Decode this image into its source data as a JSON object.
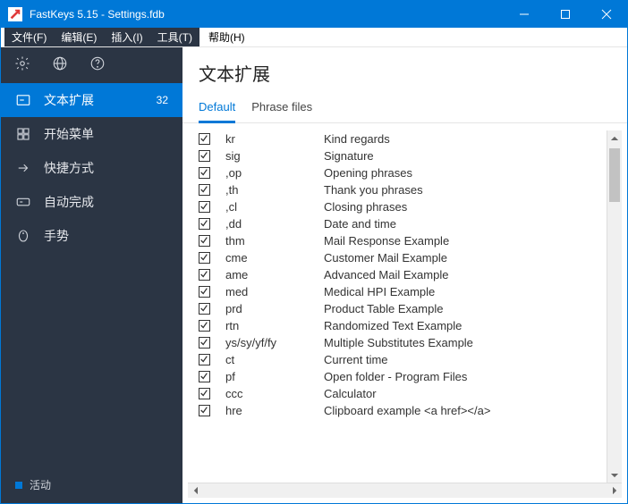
{
  "window": {
    "title": "FastKeys 5.15  -  Settings.fdb"
  },
  "menubar": {
    "group": [
      "文件(F)",
      "编辑(E)",
      "插入(I)",
      "工具(T)"
    ],
    "right": "帮助(H)"
  },
  "sidebar": {
    "items": [
      {
        "icon": "text-expand",
        "label": "文本扩展",
        "count": "32",
        "active": true
      },
      {
        "icon": "start-menu",
        "label": "开始菜单"
      },
      {
        "icon": "shortcut",
        "label": "快捷方式"
      },
      {
        "icon": "autocomplete",
        "label": "自动完成"
      },
      {
        "icon": "gesture",
        "label": "手势"
      }
    ],
    "status": "活动"
  },
  "page": {
    "title": "文本扩展",
    "tabs": [
      {
        "label": "Default",
        "active": true
      },
      {
        "label": "Phrase files",
        "active": false
      }
    ]
  },
  "rows": [
    {
      "checked": true,
      "key": "kr",
      "desc": "Kind regards"
    },
    {
      "checked": true,
      "key": "sig",
      "desc": "Signature"
    },
    {
      "checked": true,
      "key": ",op",
      "desc": "Opening phrases"
    },
    {
      "checked": true,
      "key": ",th",
      "desc": "Thank you phrases"
    },
    {
      "checked": true,
      "key": ",cl",
      "desc": "Closing phrases"
    },
    {
      "checked": true,
      "key": ",dd",
      "desc": "Date and time"
    },
    {
      "checked": true,
      "key": "thm",
      "desc": "Mail Response Example"
    },
    {
      "checked": true,
      "key": "cme",
      "desc": "Customer Mail Example"
    },
    {
      "checked": true,
      "key": "ame",
      "desc": "Advanced Mail Example"
    },
    {
      "checked": true,
      "key": "med",
      "desc": "Medical HPI Example"
    },
    {
      "checked": true,
      "key": "prd",
      "desc": "Product Table Example"
    },
    {
      "checked": true,
      "key": "rtn",
      "desc": "Randomized Text Example"
    },
    {
      "checked": true,
      "key": "ys/sy/yf/fy",
      "desc": "Multiple Substitutes Example"
    },
    {
      "checked": true,
      "key": "ct",
      "desc": "Current time"
    },
    {
      "checked": true,
      "key": "pf",
      "desc": "Open folder - Program Files"
    },
    {
      "checked": true,
      "key": "ccc",
      "desc": "Calculator"
    },
    {
      "checked": true,
      "key": "hre",
      "desc": "Clipboard example <a href></a>"
    }
  ]
}
